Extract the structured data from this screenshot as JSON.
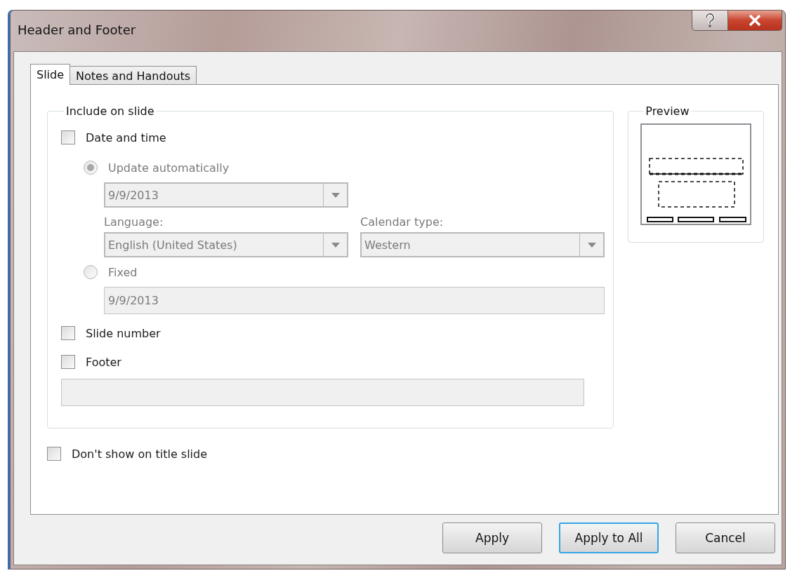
{
  "window": {
    "title": "Header and Footer"
  },
  "tabs": [
    {
      "label": "Slide",
      "selected": true
    },
    {
      "label": "Notes and Handouts",
      "selected": false
    }
  ],
  "include_on_slide": {
    "title": "Include on slide",
    "date_and_time": {
      "label": "Date and time",
      "checked": false
    },
    "date_options": {
      "disabled": true,
      "update_automatically": {
        "label": "Update automatically",
        "selected": true
      },
      "date_format": {
        "value": "9/9/2013"
      },
      "language": {
        "label": "Language:",
        "value": "English (United States)"
      },
      "calendar_type": {
        "label": "Calendar type:",
        "value": "Western"
      },
      "fixed": {
        "label": "Fixed",
        "selected": false
      },
      "fixed_date": {
        "value": "9/9/2013"
      }
    },
    "slide_number": {
      "label": "Slide number",
      "checked": false
    },
    "footer": {
      "label": "Footer",
      "checked": false
    },
    "footer_text": {
      "disabled": true
    }
  },
  "preview": {
    "title": "Preview"
  },
  "dont_show_on_title_slide": {
    "label": "Don't show on title slide",
    "checked": false
  },
  "buttons": [
    {
      "label": "Apply",
      "default": false
    },
    {
      "label": "Apply to All",
      "default": true
    },
    {
      "label": "Cancel",
      "default": false
    }
  ]
}
